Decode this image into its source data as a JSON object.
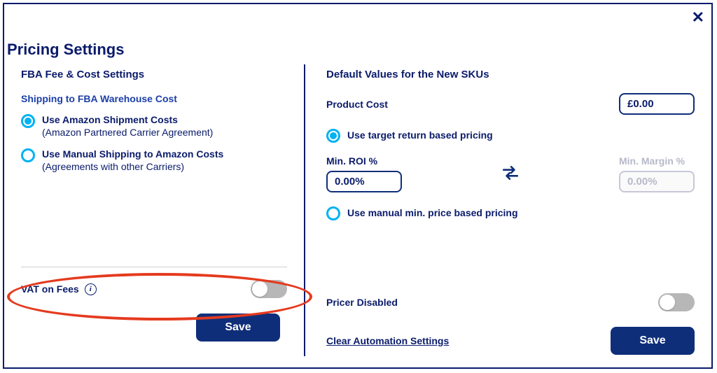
{
  "title": "Pricing Settings",
  "left": {
    "section_title": "FBA Fee & Cost Settings",
    "shipping_heading": "Shipping to FBA Warehouse Cost",
    "option1_line1": "Use Amazon Shipment Costs",
    "option1_line2": "(Amazon Partnered Carrier Agreement)",
    "option2_line1": "Use Manual Shipping to Amazon Costs",
    "option2_line2": "(Agreements with other Carriers)",
    "vat_label": "VAT on Fees",
    "save_label": "Save"
  },
  "right": {
    "section_title": "Default Values for the New SKUs",
    "product_cost_label": "Product Cost",
    "product_cost_value": "£0.00",
    "target_label": "Use target return based pricing",
    "min_roi_label": "Min. ROI %",
    "min_roi_value": "0.00%",
    "min_margin_label": "Min. Margin %",
    "min_margin_value": "0.00%",
    "manual_label": "Use manual min. price based pricing",
    "pricer_disabled_label": "Pricer Disabled",
    "clear_link": "Clear Automation Settings",
    "save_label": "Save"
  }
}
